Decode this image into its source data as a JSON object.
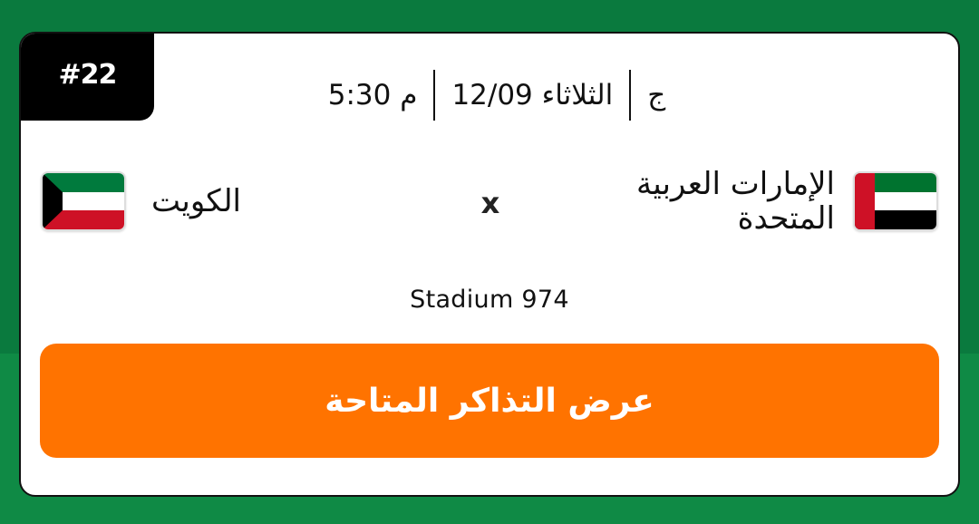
{
  "match": {
    "number": "#22",
    "day_code": "ج",
    "date": "الثلاثاء 12/09",
    "time": "5:30 م",
    "home_team": "الإمارات العربية المتحدة",
    "away_team": "الكويت",
    "vs": "x",
    "stadium": "Stadium 974",
    "cta_label": "عرض التذاكر المتاحة"
  },
  "flags": {
    "uae": {
      "icon": "uae-flag-icon",
      "colors": [
        "#00732f",
        "#ffffff",
        "#000000",
        "#ce1126"
      ]
    },
    "kuwait": {
      "icon": "kuwait-flag-icon",
      "colors": [
        "#007a3d",
        "#ffffff",
        "#ce1126",
        "#000000"
      ]
    }
  },
  "colors": {
    "background": "#0a7a3e",
    "cta": "#ff7300",
    "badge": "#000000"
  }
}
